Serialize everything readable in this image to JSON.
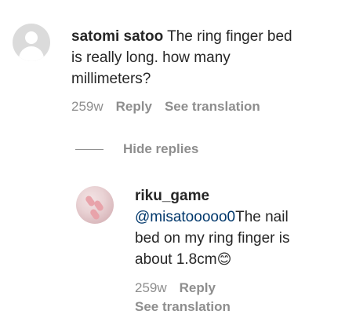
{
  "comment": {
    "username": "satomi satoo",
    "text_line1": " The ring finger bed",
    "text_line2": "is really long. how many",
    "text_line3": "millimeters?",
    "time": "259w",
    "reply_label": "Reply",
    "translate_label": "See translation"
  },
  "replies_toggle": {
    "label": "Hide replies"
  },
  "reply": {
    "username": "riku_game",
    "mention": "@misatooooo0",
    "text_line1": "The nail",
    "text_line2": "bed on my ring finger is",
    "text_line3": "about 1.8cm",
    "emoji": "😊",
    "time": "259w",
    "reply_label": "Reply",
    "translate_label": "See translation"
  }
}
